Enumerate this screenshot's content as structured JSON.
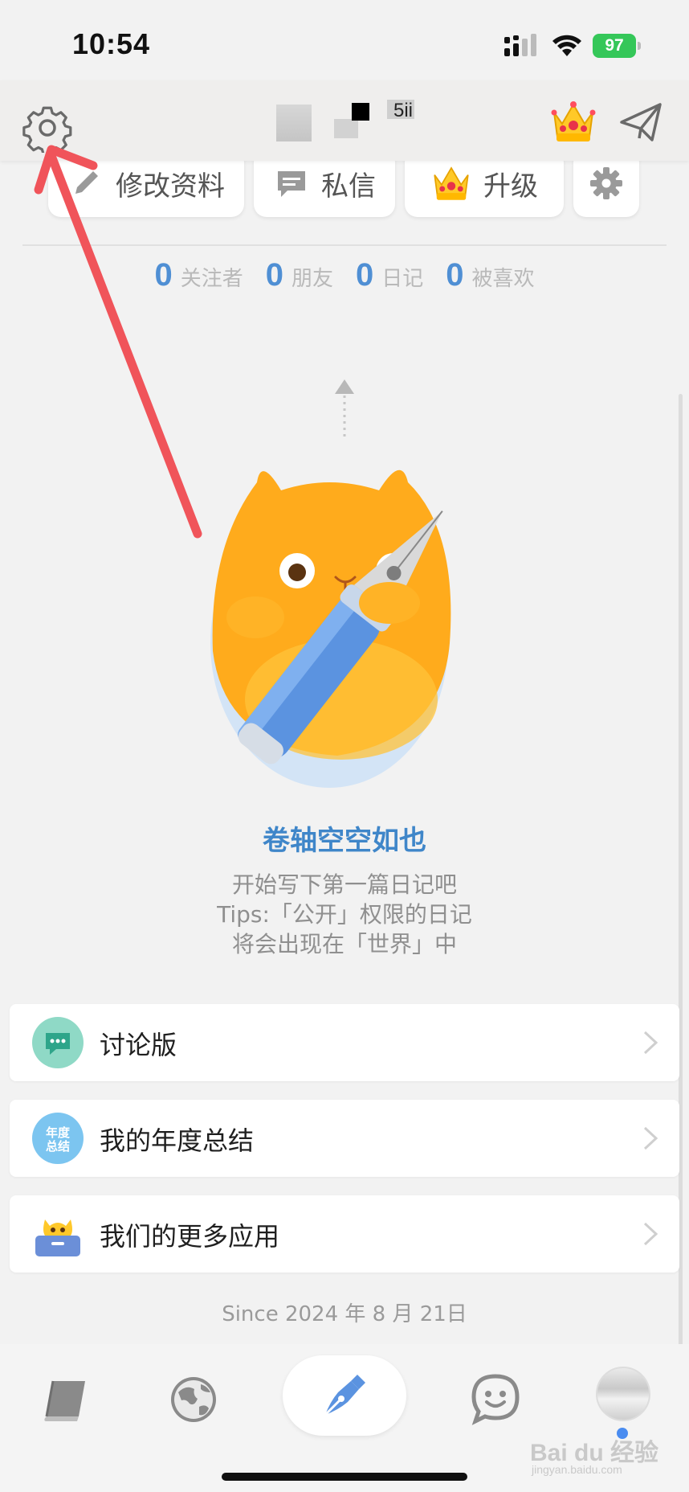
{
  "status_bar": {
    "time": "10:54",
    "battery": "97"
  },
  "header": {
    "title": "5ii"
  },
  "actions": [
    {
      "label": "修改资料",
      "icon": "pencil-icon"
    },
    {
      "label": "私信",
      "icon": "message-icon"
    },
    {
      "label": "升级",
      "icon": "crown-icon"
    },
    {
      "label": "",
      "icon": "gear-icon"
    }
  ],
  "stats": [
    {
      "count": "0",
      "label": "关注者"
    },
    {
      "count": "0",
      "label": "朋友"
    },
    {
      "count": "0",
      "label": "日记"
    },
    {
      "count": "0",
      "label": "被喜欢"
    }
  ],
  "empty_state": {
    "title": "卷轴空空如也",
    "lines": [
      "开始写下第一篇日记吧",
      "Tips:「公开」权限的日记",
      "将会出现在「世界」中"
    ]
  },
  "menu": [
    {
      "label": "讨论版",
      "icon": "chat-bubble-icon"
    },
    {
      "label": "我的年度总结",
      "icon": "annual-summary-icon",
      "icon_text": "年度总结"
    },
    {
      "label": "我们的更多应用",
      "icon": "more-apps-icon"
    }
  ],
  "since": "Since 2024 年 8 月 21日",
  "tab_bar": [
    {
      "name": "diary",
      "icon": "book-icon"
    },
    {
      "name": "world",
      "icon": "globe-icon"
    },
    {
      "name": "write",
      "icon": "pen-nib-icon"
    },
    {
      "name": "chat",
      "icon": "smiley-chat-icon"
    },
    {
      "name": "profile",
      "icon": "avatar"
    }
  ],
  "watermark": {
    "text": "Bai du 经验",
    "sub": "jingyan.baidu.com"
  },
  "colors": {
    "accent": "#3f86c9",
    "stat_number": "#4f8fd4",
    "annotation": "#f0545a",
    "battery": "#35c759"
  }
}
